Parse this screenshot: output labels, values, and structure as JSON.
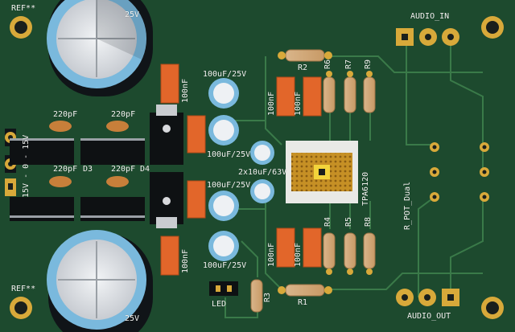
{
  "board": {
    "background": "#1d4a2e",
    "copper": "#2f6a40",
    "trace": "#3a7a49",
    "gold": "#d8a93a",
    "silkscreen": "#f4f4f2"
  },
  "labels": {
    "ref_top": "REF**",
    "ref_bottom": "REF**",
    "cap_top_value": "25V",
    "cap_bottom_value": "25V",
    "c_100nf_1": "100nF",
    "c_100nf_2": "100nF",
    "c_100nf_3": "100nF",
    "c_100nf_4": "100nF",
    "c_100nf_5": "100nF",
    "c_100nf_6": "100nF",
    "c_100uf_1": "100uF/25V",
    "c_100uf_2": "100uF/25V",
    "c_100uf_3": "100uF/25V",
    "c_100uf_4": "100uF/25V",
    "c_2x10uf": "2x10uF/63V",
    "c_220pf_1": "220pF",
    "c_220pf_2": "220pF",
    "c_220pf_3": "220pF",
    "c_220pf_4": "220pF",
    "d3": "D3",
    "d4": "D4",
    "power_label": "15V - 0 - 15V",
    "r1": "R1",
    "r2": "R2",
    "r3": "R3",
    "r4": "R4",
    "r5": "R5",
    "r6": "R6",
    "r7": "R7",
    "r8": "R8",
    "r9": "R9",
    "ic": "TPA6120",
    "pot": "R_POT_Dual",
    "audio_in": "AUDIO_IN",
    "audio_out": "AUDIO_OUT",
    "led": "LED"
  }
}
